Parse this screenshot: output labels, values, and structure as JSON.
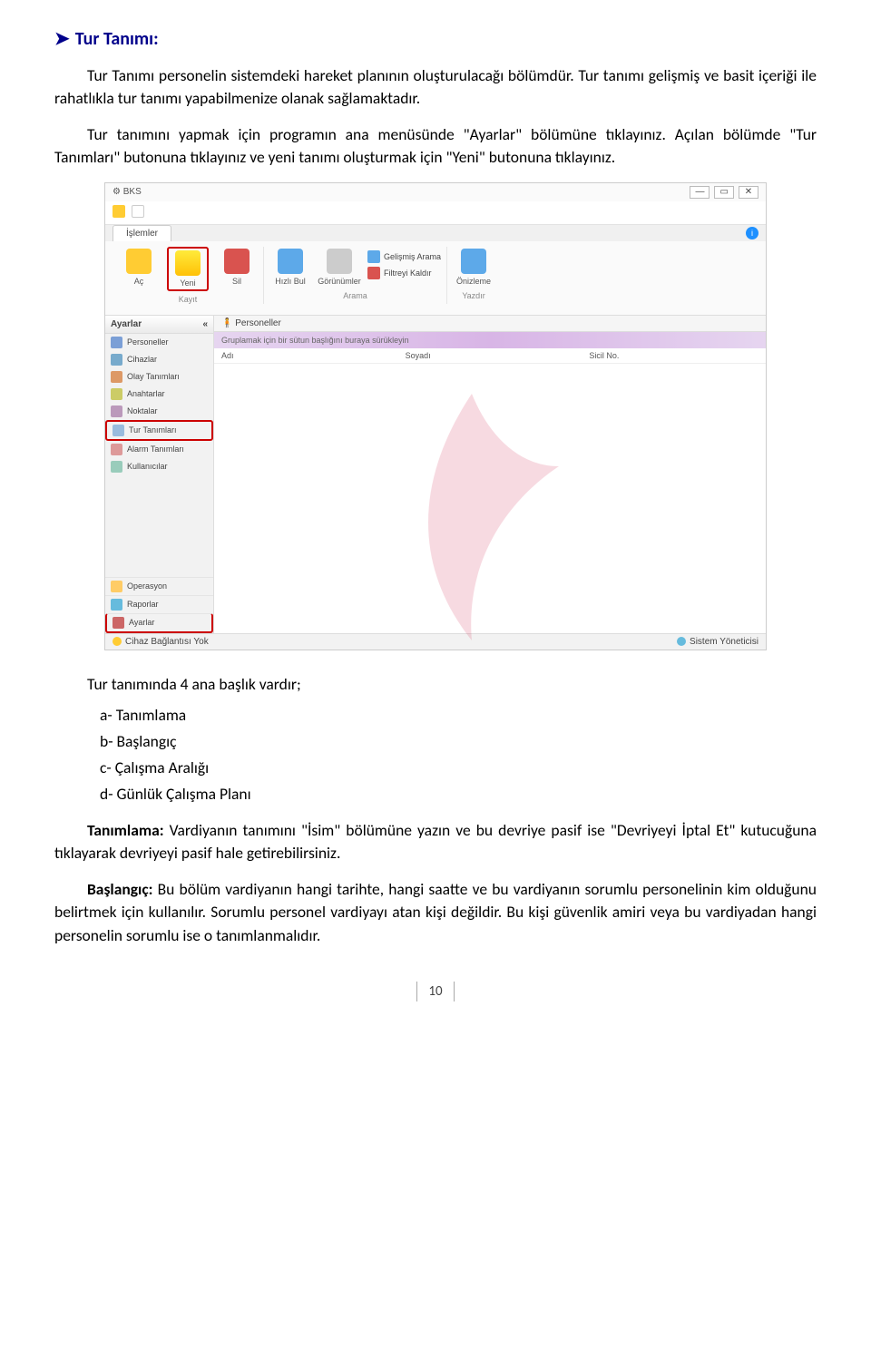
{
  "heading": "Tur Tanımı:",
  "para1": "Tur Tanımı personelin sistemdeki hareket planının oluşturulacağı bölümdür. Tur tanımı gelişmiş ve basit içeriği ile rahatlıkla tur tanımı yapabilmenize olanak sağlamaktadır.",
  "para2": "Tur tanımını yapmak için programın ana menüsünde \"Ayarlar\" bölümüne tıklayınız. Açılan bölümde \"Tur Tanımları\" butonuna tıklayınız ve yeni tanımı oluşturmak için \"Yeni\" butonuna tıklayınız.",
  "screenshot": {
    "title": "BKS",
    "tab": "İşlemler",
    "ribbon": {
      "kayit": {
        "ac": "Aç",
        "yeni": "Yeni",
        "sil": "Sil",
        "label": "Kayıt"
      },
      "arama": {
        "hizlibul": "Hızlı Bul",
        "gorunumler": "Görünümler",
        "gelismis": "Gelişmiş Arama",
        "filtreyi": "Filtreyi Kaldır",
        "label": "Arama"
      },
      "yazdir": {
        "onizleme": "Önizleme",
        "label": "Yazdır"
      }
    },
    "sidebar": {
      "header": "Ayarlar",
      "items": [
        "Personeller",
        "Cihazlar",
        "Olay Tanımları",
        "Anahtarlar",
        "Noktalar",
        "Tur Tanımları",
        "Alarm Tanımları",
        "Kullanıcılar"
      ],
      "bottom": [
        "Operasyon",
        "Raporlar",
        "Ayarlar"
      ]
    },
    "main": {
      "tab": "Personeller",
      "grouphdr": "Gruplamak için bir sütun başlığını buraya sürükleyin",
      "cols": [
        "Adı",
        "Soyadı",
        "Sicil No."
      ]
    },
    "status": {
      "left": "Cihaz Bağlantısı Yok",
      "right": "Sistem Yöneticisi"
    }
  },
  "subhead": "Tur tanımında 4 ana başlık vardır;",
  "list": {
    "a": "a-  Tanımlama",
    "b": "b-  Başlangıç",
    "c": "c-  Çalışma Aralığı",
    "d": "d-  Günlük Çalışma Planı"
  },
  "para3_label": "Tanımlama:",
  "para3": " Vardiyanın tanımını \"İsim\" bölümüne yazın ve bu devriye pasif ise \"Devriyeyi İptal Et\" kutucuğuna tıklayarak devriyeyi pasif hale getirebilirsiniz.",
  "para4_label": "Başlangıç:",
  "para4": " Bu bölüm vardiyanın hangi tarihte, hangi saatte ve bu vardiyanın sorumlu personelinin kim olduğunu belirtmek için kullanılır. Sorumlu personel vardiyayı atan kişi değildir. Bu kişi güvenlik amiri veya bu vardiyadan hangi personelin sorumlu ise o tanımlanmalıdır.",
  "page": "10"
}
